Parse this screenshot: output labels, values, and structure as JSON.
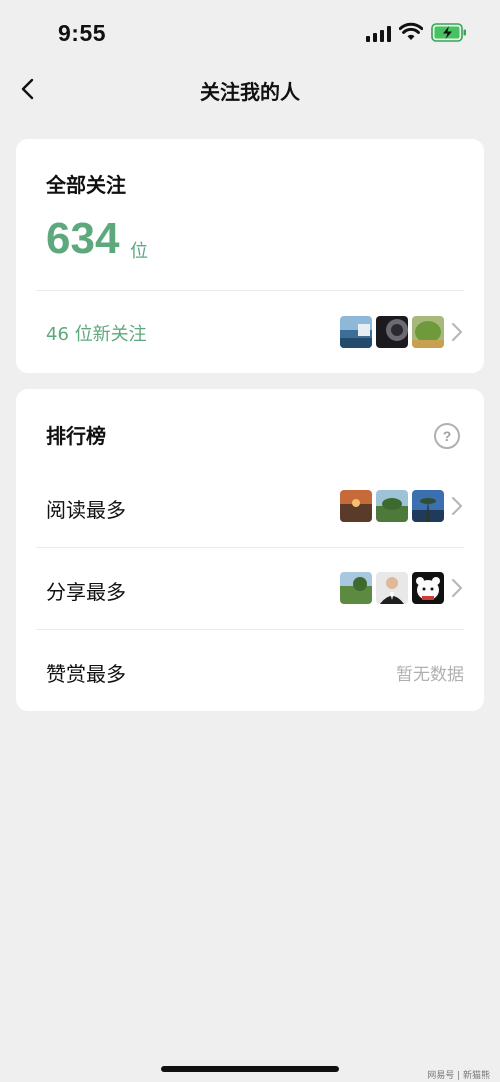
{
  "status_bar": {
    "time": "9:55"
  },
  "nav": {
    "title": "关注我的人"
  },
  "followers": {
    "label": "全部关注",
    "count": "634",
    "unit": "位",
    "new_text": "46 位新关注"
  },
  "ranking": {
    "title": "排行榜",
    "help": "?",
    "rows": [
      {
        "label": "阅读最多"
      },
      {
        "label": "分享最多"
      },
      {
        "label": "赞赏最多",
        "empty_text": "暂无数据"
      }
    ]
  },
  "watermark": "网易号 | 新猫熊"
}
